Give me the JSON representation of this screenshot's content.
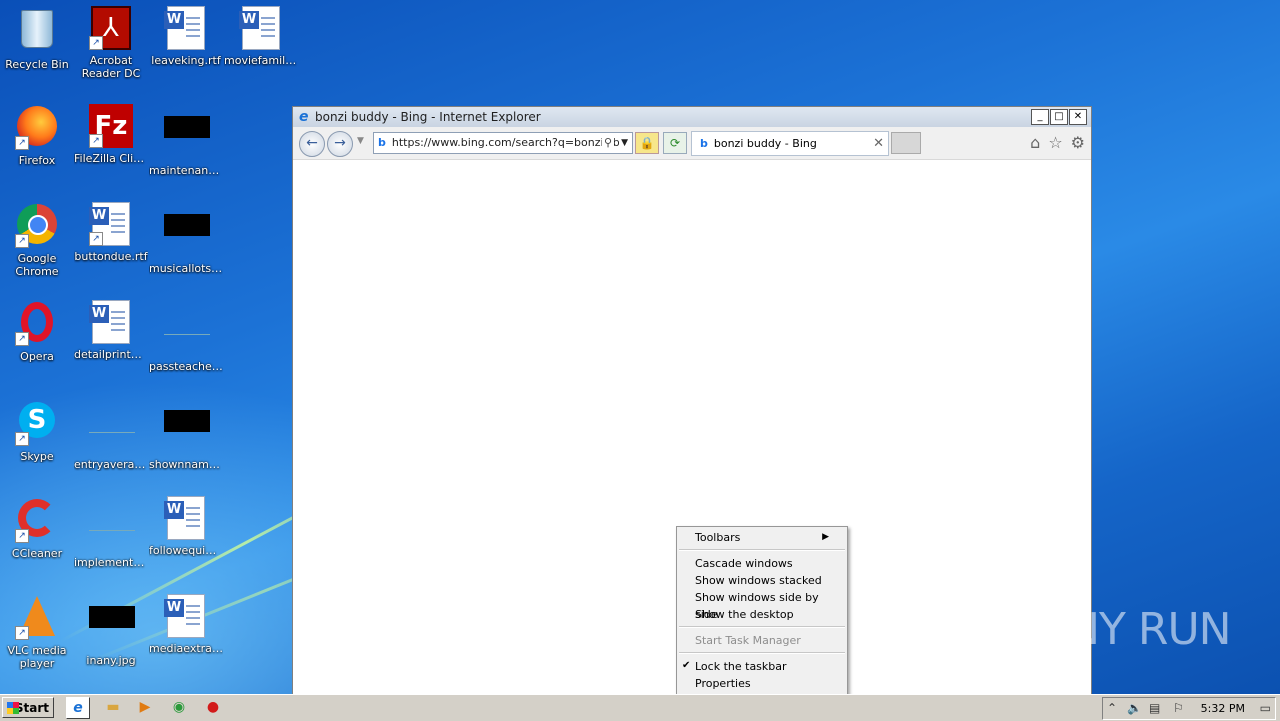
{
  "desktop": {
    "icons": [
      {
        "label": "Recycle Bin"
      },
      {
        "label": "Acrobat\nReader DC"
      },
      {
        "label": "leaveking.rtf"
      },
      {
        "label": "moviefamily...."
      },
      {
        "label": "Firefox"
      },
      {
        "label": "FileZilla Client"
      },
      {
        "label": "maintenanc..."
      },
      {
        "label": "Google\nChrome"
      },
      {
        "label": "buttondue.rtf"
      },
      {
        "label": "musicallots.jpg"
      },
      {
        "label": "Opera"
      },
      {
        "label": "detailprinter...."
      },
      {
        "label": "passteache...."
      },
      {
        "label": "Skype"
      },
      {
        "label": "entryavera...."
      },
      {
        "label": "shownname...."
      },
      {
        "label": "CCleaner"
      },
      {
        "label": "implementa...."
      },
      {
        "label": "followequip...."
      },
      {
        "label": "VLC media\nplayer"
      },
      {
        "label": "inany.jpg"
      },
      {
        "label": "mediaextra.rtf"
      }
    ]
  },
  "ie_window": {
    "title": "bonzi buddy - Bing - Internet Explorer",
    "address_url": "https://www.bing.com/search?q=bonzi+b",
    "tab_label": "bonzi buddy - Bing",
    "icons": [
      "back-icon",
      "forward-icon",
      "home-icon",
      "favorites-icon",
      "settings-icon"
    ]
  },
  "context_menu": {
    "items": {
      "toolbars": "Toolbars",
      "cascade": "Cascade windows",
      "stacked": "Show windows stacked",
      "side_by_side": "Show windows side by side",
      "show_desktop": "Show the desktop",
      "task_manager": "Start Task Manager",
      "lock_taskbar": "Lock the taskbar",
      "properties": "Properties"
    }
  },
  "taskbar": {
    "start_label": "Start",
    "clock": "5:32 PM"
  },
  "watermark": "ANY RUN"
}
